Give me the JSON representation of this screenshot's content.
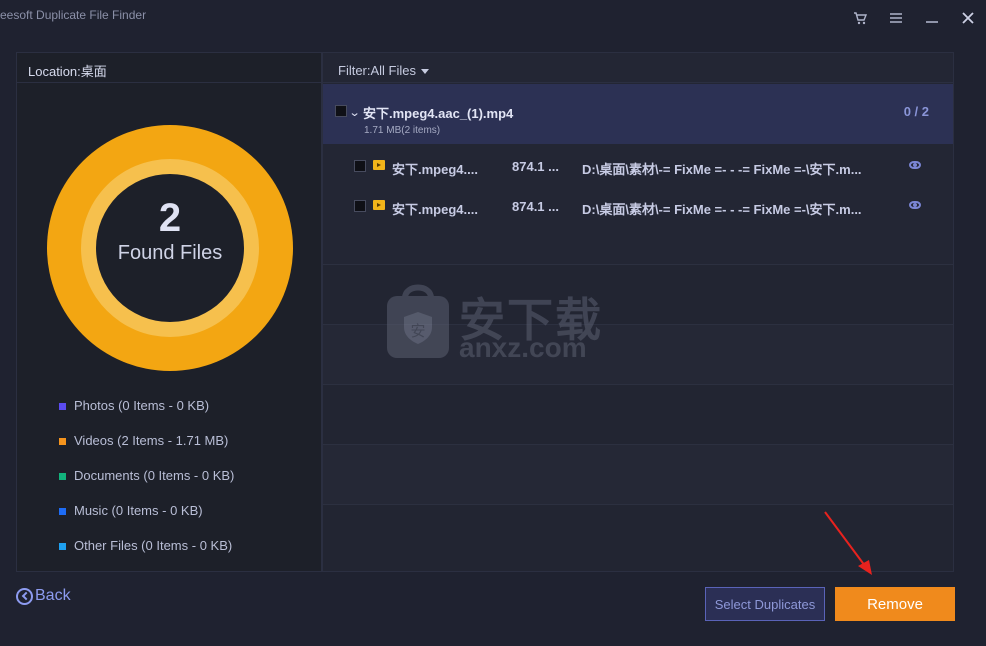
{
  "window": {
    "title": "eesoft Duplicate File Finder"
  },
  "left_panel": {
    "location_label": "Location:桌面",
    "found_count": "2",
    "found_label": "Found Files",
    "legend": [
      {
        "label": "Photos (0 Items - 0 KB)",
        "color": "#5b4bf0"
      },
      {
        "label": "Videos (2 Items - 1.71 MB)",
        "color": "#f5941d"
      },
      {
        "label": "Documents (0 Items - 0 KB)",
        "color": "#12b37c"
      },
      {
        "label": "Music (0 Items - 0 KB)",
        "color": "#1e6cf5"
      },
      {
        "label": "Other Files (0 Items - 0 KB)",
        "color": "#1ea0f0"
      }
    ]
  },
  "right_panel": {
    "filter_label": "Filter:All Files",
    "group": {
      "name": "安下.mpeg4.aac_(1).mp4",
      "size": "1.71 MB(2 items)",
      "count": "0 / 2"
    },
    "files": [
      {
        "name": "安下.mpeg4....",
        "size": "874.1 ...",
        "path": "D:\\桌面\\素材\\-= FixMe =- - -= FixMe =-\\安下.m..."
      },
      {
        "name": "安下.mpeg4....",
        "size": "874.1 ...",
        "path": "D:\\桌面\\素材\\-= FixMe =- - -= FixMe =-\\安下.m..."
      }
    ]
  },
  "watermark": {
    "text": "安下载",
    "sub": "anxz.com",
    "badge": "安"
  },
  "footer": {
    "back_label": "Back",
    "select_duplicates_label": "Select Duplicates",
    "remove_label": "Remove"
  },
  "colors": {
    "accent_orange": "#f08a1c",
    "donut_outer": "#f3a612",
    "donut_inner": "#f6c04d",
    "group_highlight": "#2c3154"
  }
}
